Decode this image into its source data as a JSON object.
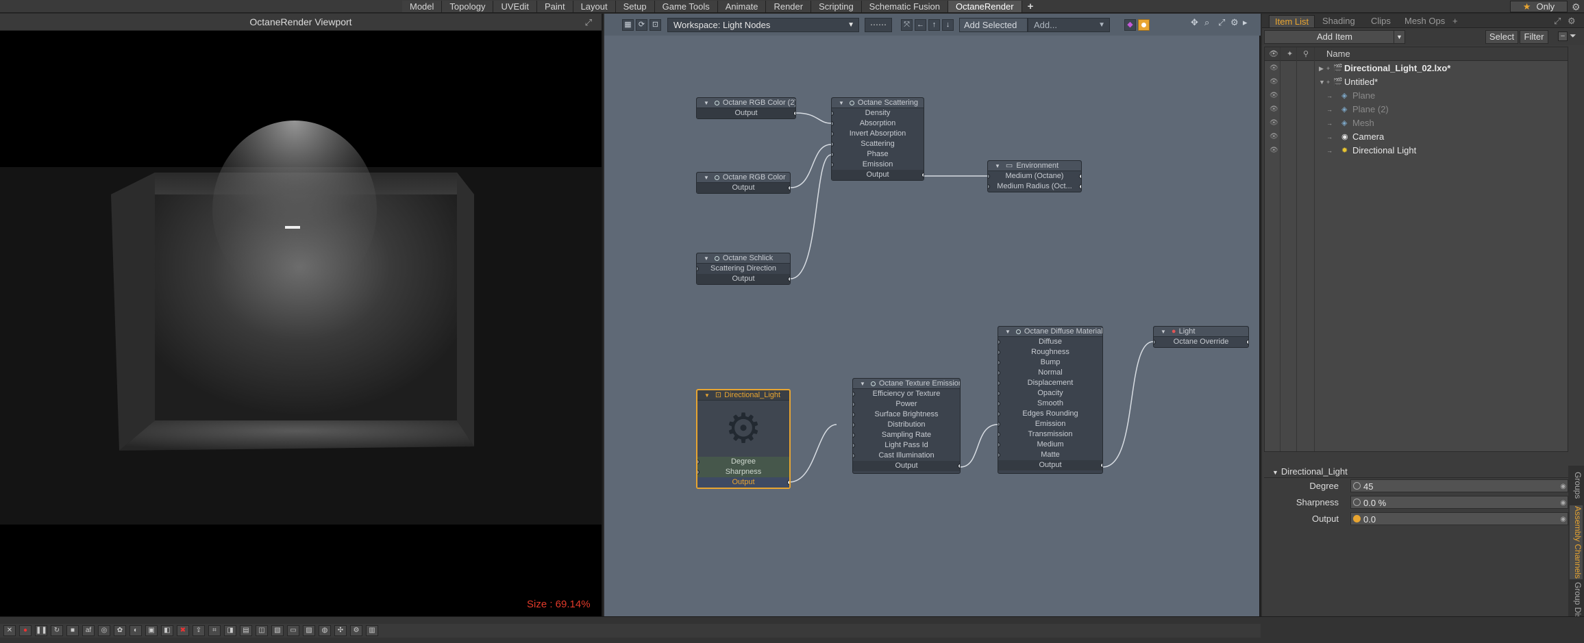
{
  "menu": {
    "tabs": [
      "Model",
      "Topology",
      "UVEdit",
      "Paint",
      "Layout",
      "Setup",
      "Game Tools",
      "Animate",
      "Render",
      "Scripting",
      "Schematic Fusion",
      "OctaneRender"
    ],
    "active_tab": "OctaneRender",
    "add": "+",
    "only_label": "Only",
    "star": "★"
  },
  "viewport": {
    "title": "OctaneRender Viewport",
    "size_label": "Size : 69.14%",
    "expand_icon": "⤢"
  },
  "node_editor": {
    "workspace": "Workspace: Light Nodes",
    "add_selected": "Add Selected",
    "add_placeholder": "Add...",
    "grid_icon": "⋯⋯",
    "nodes": {
      "rgb2": {
        "title": "Octane RGB Color (2)",
        "rows": [
          "Output"
        ]
      },
      "rgb": {
        "title": "Octane RGB Color",
        "rows": [
          "Output"
        ]
      },
      "schlick": {
        "title": "Octane Schlick",
        "rows": [
          "Scattering Direction",
          "Output"
        ]
      },
      "scattering": {
        "title": "Octane Scattering",
        "rows": [
          "Density",
          "Absorption",
          "Invert Absorption",
          "Scattering",
          "Phase",
          "Emission",
          "Output"
        ]
      },
      "environment": {
        "title": "Environment",
        "rows": [
          "Medium (Octane)",
          "Medium Radius (Oct..."
        ]
      },
      "dirlight": {
        "title": "Directional_Light",
        "rows": [
          "Degree",
          "Sharpness",
          "Output"
        ]
      },
      "texemission": {
        "title": "Octane Texture Emission",
        "rows": [
          "Efficiency or Texture",
          "Power",
          "Surface Brightness",
          "Distribution",
          "Sampling Rate",
          "Light Pass Id",
          "Cast Illumination",
          "Output"
        ]
      },
      "diffuse": {
        "title": "Octane Diffuse Material",
        "rows": [
          "Diffuse",
          "Roughness",
          "Bump",
          "Normal",
          "Displacement",
          "Opacity",
          "Smooth",
          "Edges Rounding",
          "Emission",
          "Transmission",
          "Medium",
          "Matte",
          "Output"
        ]
      },
      "light": {
        "title": "Light",
        "rows": [
          "Octane Override"
        ]
      }
    }
  },
  "right_panel": {
    "tabs": [
      "Item List",
      "Shading",
      "Clips",
      "Mesh Ops"
    ],
    "active_tab": "Item List",
    "add_item": "Add Item",
    "select": "Select",
    "filter": "Filter",
    "column_name": "Name",
    "items": [
      {
        "label": "Directional_Light_02.lxo*",
        "bold": true,
        "dim": false
      },
      {
        "label": "Untitled*",
        "bold": false,
        "dim": false
      },
      {
        "label": "Plane",
        "bold": false,
        "dim": true
      },
      {
        "label": "Plane (2)",
        "bold": false,
        "dim": true
      },
      {
        "label": "Mesh",
        "bold": false,
        "dim": true
      },
      {
        "label": "Camera",
        "bold": false,
        "dim": false
      },
      {
        "label": "Directional Light",
        "bold": false,
        "dim": false
      }
    ],
    "properties": {
      "title": "Directional_Light",
      "rows": [
        {
          "label": "Degree",
          "value": "45"
        },
        {
          "label": "Sharpness",
          "value": "0.0 %"
        },
        {
          "label": "Output",
          "value": "0.0"
        }
      ]
    },
    "side_tabs": [
      "Groups",
      "Assembly Channels",
      "Group Displ"
    ]
  },
  "colors": {
    "accent": "#e8a531",
    "node_bg": "#5f6976",
    "size_label": "#e23a2a"
  }
}
